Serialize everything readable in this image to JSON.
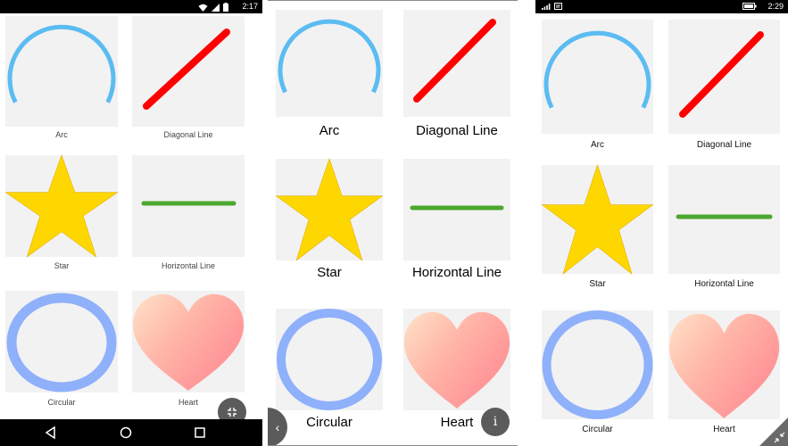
{
  "colors": {
    "arc": "#5bbcf2",
    "diagonal_line": "#ff0000",
    "star": "#ffd700",
    "horizontal_line": "#4ca72e",
    "circular": "#8fb0fb",
    "heart_light": "#ffe2c8",
    "heart_dark": "#ff8c93",
    "tile_bg": "#f2f2f2"
  },
  "shapes": [
    "Arc",
    "Diagonal Line",
    "Star",
    "Horizontal Line",
    "Circular",
    "Heart"
  ],
  "android": {
    "statusbar": {
      "time": "2:17"
    },
    "fab_icon": "collapse-icon"
  },
  "ios": {
    "back_icon": "‹",
    "info_button": "i"
  },
  "uwp": {
    "statusbar": {
      "time": "2:29"
    },
    "corner_icon": "collapse-icon"
  }
}
